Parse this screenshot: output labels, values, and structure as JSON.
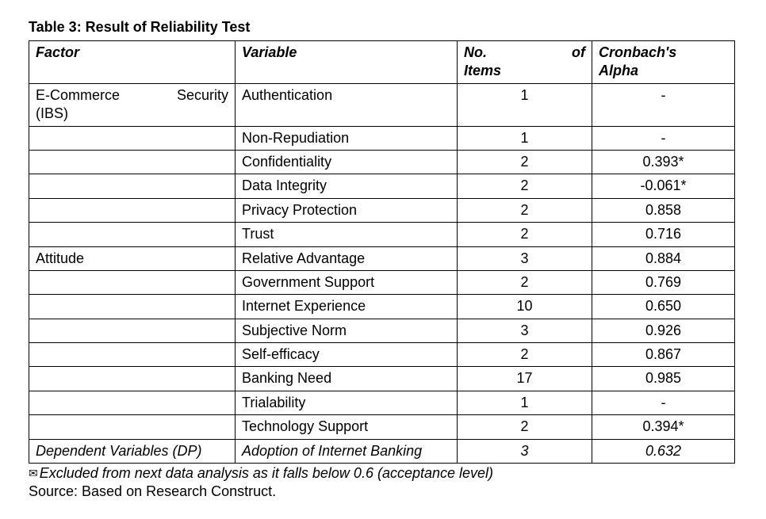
{
  "title": "Table 3: Result of Reliability Test",
  "headers": {
    "factor": "Factor",
    "variable": "Variable",
    "no_of_items_a": "No.",
    "no_of_items_b": "of",
    "no_of_items_c": "Items",
    "alpha_a": "Cronbach's",
    "alpha_b": "Alpha"
  },
  "rows": [
    {
      "factor_a": "E-Commerce",
      "factor_b": "Security",
      "factor_c": "(IBS)",
      "variable": "Authentication",
      "items": "1",
      "alpha": "-"
    },
    {
      "factor": "",
      "variable": "Non-Repudiation",
      "items": "1",
      "alpha": "-"
    },
    {
      "factor": "",
      "variable": "Confidentiality",
      "items": "2",
      "alpha": "0.393*"
    },
    {
      "factor": "",
      "variable": "Data Integrity",
      "items": "2",
      "alpha": "-0.061*"
    },
    {
      "factor": "",
      "variable": "Privacy Protection",
      "items": "2",
      "alpha": "0.858"
    },
    {
      "factor": "",
      "variable": "Trust",
      "items": "2",
      "alpha": "0.716"
    },
    {
      "factor": "Attitude",
      "variable": "Relative Advantage",
      "items": "3",
      "alpha": "0.884"
    },
    {
      "factor": "",
      "variable": "Government Support",
      "items": "2",
      "alpha": "0.769"
    },
    {
      "factor": "",
      "variable": "Internet Experience",
      "items": "10",
      "alpha": "0.650"
    },
    {
      "factor": "",
      "variable": "Subjective Norm",
      "items": "3",
      "alpha": "0.926"
    },
    {
      "factor": "",
      "variable": "Self-efficacy",
      "items": "2",
      "alpha": "0.867"
    },
    {
      "factor": "",
      "variable": "Banking Need",
      "items": "17",
      "alpha": "0.985"
    },
    {
      "factor": "",
      "variable": "Trialability",
      "items": "1",
      "alpha": "-"
    },
    {
      "factor": "",
      "variable": "Technology Support",
      "items": "2",
      "alpha": "0.394*"
    },
    {
      "factor": "Dependent Variables (DP)",
      "variable": "Adoption of Internet Banking",
      "items": "3",
      "alpha": "0.632",
      "italic": true
    }
  ],
  "footnote_icon": "✉",
  "footnote": "Excluded from next data analysis as it falls below 0.6 (acceptance level)",
  "source": "Source: Based on Research Construct."
}
